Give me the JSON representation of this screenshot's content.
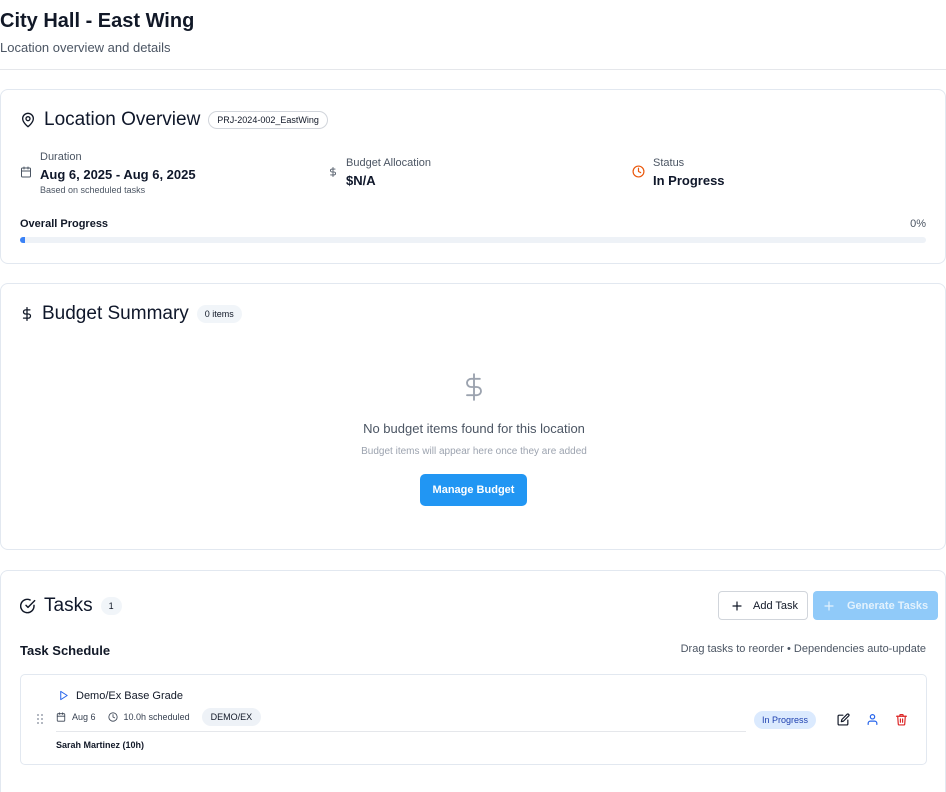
{
  "header": {
    "title": "City Hall - East Wing",
    "subtitle": "Location overview and details"
  },
  "overview": {
    "title": "Location Overview",
    "project_code": "PRJ-2024-002_EastWing",
    "duration": {
      "label": "Duration",
      "value": "Aug 6, 2025 - Aug 6, 2025",
      "note": "Based on scheduled tasks",
      "icon": "calendar-icon"
    },
    "budget": {
      "label": "Budget Allocation",
      "value": "$N/A",
      "icon": "dollar-icon"
    },
    "status": {
      "label": "Status",
      "value": "In Progress",
      "icon": "clock-icon",
      "icon_color": "#ea580c"
    },
    "progress": {
      "label": "Overall Progress",
      "percent_text": "0%",
      "percent": 0.5
    }
  },
  "budget_summary": {
    "title": "Budget Summary",
    "count_badge": "0 items",
    "empty_title": "No budget items found for this location",
    "empty_subtitle": "Budget items will appear here once they are added",
    "manage_button": "Manage Budget",
    "accent": "#2196f3"
  },
  "tasks": {
    "title": "Tasks",
    "count": "1",
    "add_button": "Add Task",
    "generate_button": "Generate Tasks",
    "schedule_title": "Task Schedule",
    "schedule_hint": "Drag tasks to reorder • Dependencies auto-update",
    "items": [
      {
        "name": "Demo/Ex Base Grade",
        "date": "Aug 6",
        "hours": "10.0h scheduled",
        "tag": "DEMO/EX",
        "assignee": "Sarah Martinez (10h)",
        "status": "In Progress",
        "status_color": "#dbeafe"
      }
    ]
  }
}
